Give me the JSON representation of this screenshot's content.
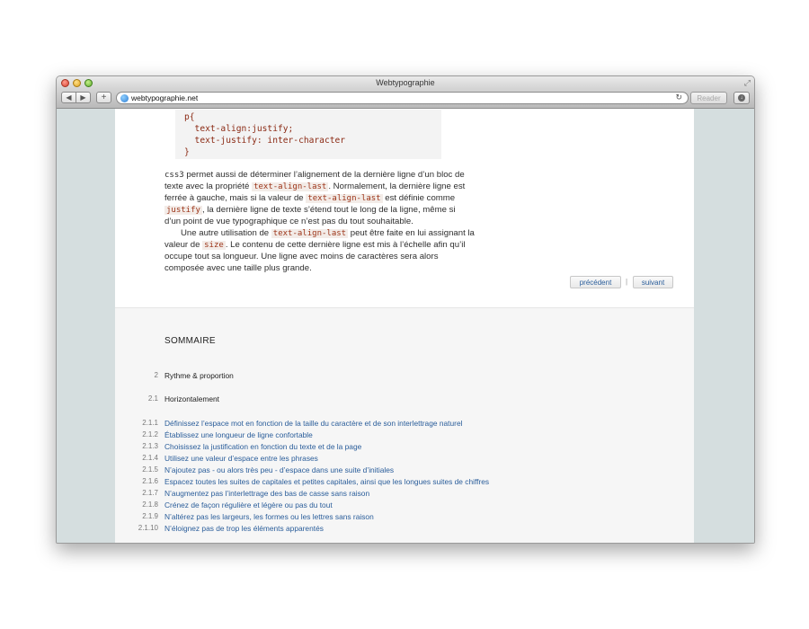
{
  "window": {
    "title": "Webtypographie"
  },
  "toolbar": {
    "url": "webtypographie.net",
    "reader_label": "Reader",
    "back_label": "◀",
    "forward_label": "▶",
    "add_label": "+"
  },
  "code_block": {
    "lines": [
      "p{",
      "  text-align:justify;",
      "  text-justify: inter-character",
      "}"
    ]
  },
  "paragraph1": {
    "line1": {
      "a": "css3",
      "b": " permet aussi de déterminer l’alignement de la dernière ligne d’un bloc de"
    },
    "line2": {
      "a": "texte avec la propriété ",
      "code": "text-align-last",
      "b": ". Normalement, la dernière ligne est"
    },
    "line3": {
      "a": "ferrée à gauche, mais si la valeur de ",
      "code": "text-align-last",
      "b": " est définie comme"
    },
    "line4": {
      "code": "justify",
      "b": ", la dernière ligne de texte s’étend tout le long de la ligne, même si"
    },
    "line5": "d’un point de vue typographique ce n’est pas du tout souhaitable."
  },
  "paragraph2": {
    "line1": {
      "a": "Une autre utilisation de ",
      "code": "text-align-last",
      "b": " peut être faite en lui assignant la"
    },
    "line2": {
      "a": "valeur de ",
      "code": "size",
      "b": ". Le contenu de cette dernière ligne est mis à l’échelle afin qu’il"
    },
    "line3": "occupe tout sa longueur. Une ligne avec moins de caractères sera alors",
    "line4": "composée avec une taille plus grande."
  },
  "pagination": {
    "previous": "précédent",
    "separator": "|",
    "next": "suivant"
  },
  "toc": {
    "heading": "SOMMAIRE",
    "chapter": {
      "num": "2",
      "title": "Rythme & proportion"
    },
    "section": {
      "num": "2.1",
      "title": "Horizontalement"
    },
    "items": [
      {
        "num": "2.1.1",
        "title": "Définissez l’espace mot en fonction de la taille du caractère et de son interlettrage naturel"
      },
      {
        "num": "2.1.2",
        "title": "Établissez une longueur de ligne confortable"
      },
      {
        "num": "2.1.3",
        "title": "Choisissez la justification en fonction du texte et de la page"
      },
      {
        "num": "2.1.4",
        "title": "Utilisez une valeur d’espace entre les phrases"
      },
      {
        "num": "2.1.5",
        "title": "N’ajoutez pas - ou alors très peu - d’espace dans une suite d’initiales"
      },
      {
        "num": "2.1.6",
        "title": "Espacez toutes les suites de capitales et petites capitales, ainsi que les longues suites de chiffres"
      },
      {
        "num": "2.1.7",
        "title": "N’augmentez pas l’interlettrage des bas de casse sans raison"
      },
      {
        "num": "2.1.8",
        "title": "Crénez de façon régulière et légère ou pas du tout"
      },
      {
        "num": "2.1.9",
        "title": "N’altérez pas les largeurs, les formes ou les lettres sans raison"
      },
      {
        "num": "2.1.10",
        "title": "N’éloignez pas de trop les éléments apparentés"
      }
    ]
  }
}
